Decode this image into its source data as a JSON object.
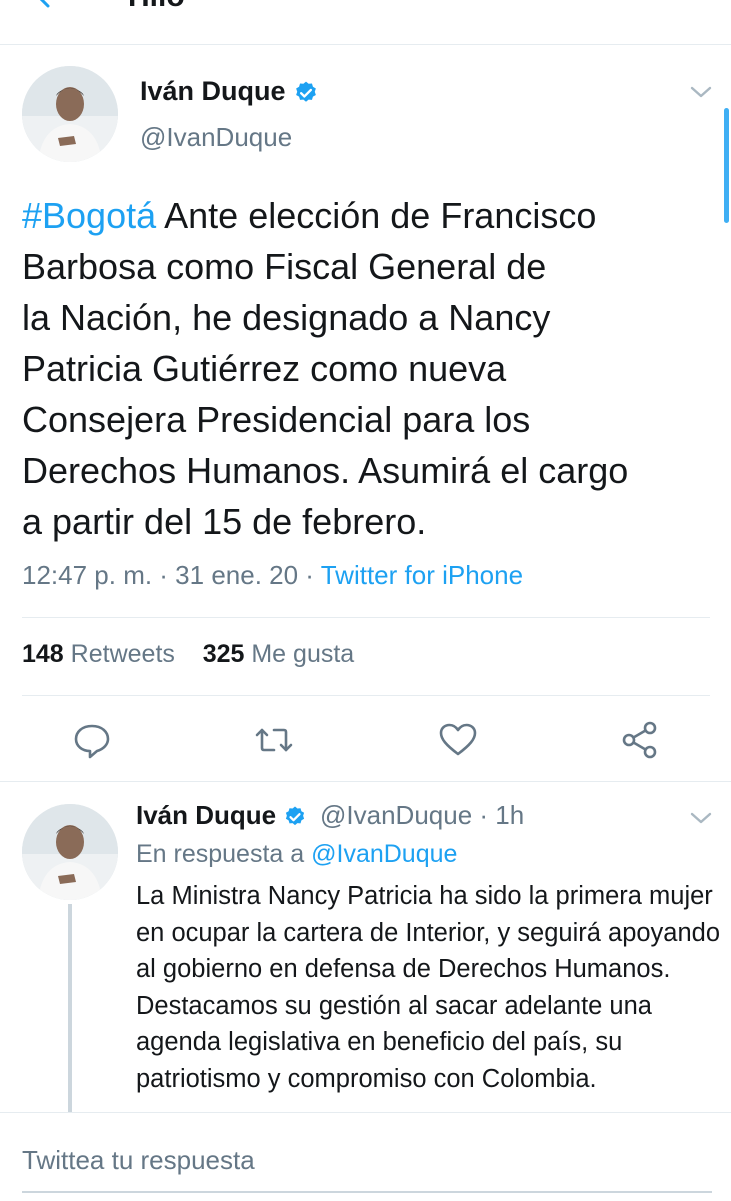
{
  "header": {
    "title": "Hilo",
    "back_icon": "back-arrow-icon"
  },
  "tweet": {
    "author_name": "Iván Duque",
    "handle": "@IvanDuque",
    "hashtag": "#Bogotá",
    "text": " Ante elección de Francisco\nBarbosa como Fiscal General de\nla Nación, he designado a Nancy\nPatricia Gutiérrez como nueva\nConsejera Presidencial para los\nDerechos Humanos. Asumirá el cargo\na partir del 15 de febrero.",
    "time": "12:47 p. m. · 31 ene. 20 · ",
    "source": "Twitter for iPhone",
    "retweets_count": "148",
    "retweets_label": "Retweets",
    "likes_count": "325",
    "likes_label": "Me gusta"
  },
  "actions": {
    "reply_icon": "reply-icon",
    "retweet_icon": "retweet-icon",
    "like_icon": "heart-icon",
    "share_icon": "share-icon"
  },
  "reply": {
    "author_name": "Iván Duque",
    "handle_time": "@IvanDuque · 1h",
    "in_reply_prefix": "En respuesta a ",
    "in_reply_handle": "@IvanDuque",
    "text": "La Ministra Nancy Patricia ha sido la primera mujer en ocupar la cartera de Interior, y seguirá apoyando al gobierno en defensa de Derechos Humanos. Destacamos su gestión al sacar adelante una agenda legislativa en beneficio del país, su patriotismo y compromiso con Colombia."
  },
  "compose": {
    "placeholder": "Twittea tu respuesta"
  },
  "colors": {
    "accent": "#1da1f2",
    "muted": "#657786",
    "text": "#14171a",
    "divider": "#e6ecf0"
  }
}
